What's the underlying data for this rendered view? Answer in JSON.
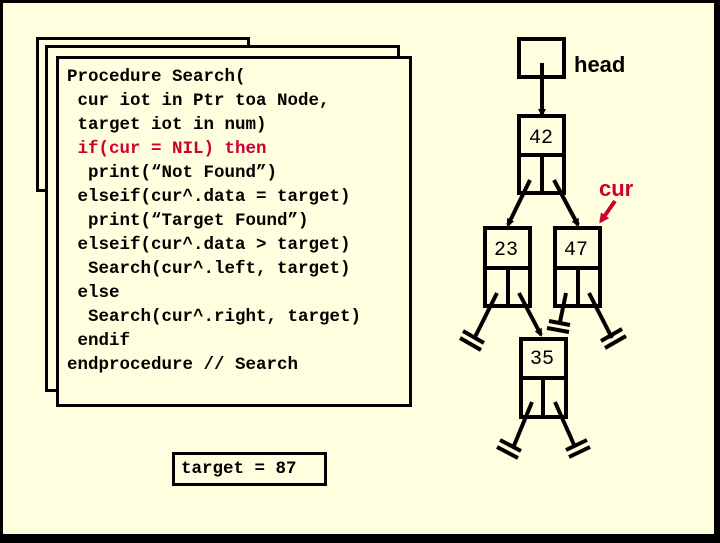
{
  "procedure": {
    "lines": [
      {
        "text": "Procedure Search(",
        "color": "black"
      },
      {
        "text": " cur iot in Ptr toa Node,",
        "color": "black"
      },
      {
        "text": " target iot in num)",
        "color": "black"
      },
      {
        "text": " if(cur = NIL) then",
        "color": "red"
      },
      {
        "text": "  print(“Not Found”)",
        "color": "black"
      },
      {
        "text": " elseif(cur^.data = target)",
        "color": "black"
      },
      {
        "text": "  print(“Target Found”)",
        "color": "black"
      },
      {
        "text": " elseif(cur^.data > target)",
        "color": "black"
      },
      {
        "text": "  Search(cur^.left, target)",
        "color": "black"
      },
      {
        "text": " else",
        "color": "black"
      },
      {
        "text": "  Search(cur^.right, target)",
        "color": "black"
      },
      {
        "text": " endif",
        "color": "black"
      },
      {
        "text": "endprocedure // Search",
        "color": "black"
      }
    ]
  },
  "target_label": "target = 87",
  "tree": {
    "head_label": "head",
    "cur_label": "cur",
    "nodes": [
      {
        "id": "n42",
        "value": "42"
      },
      {
        "id": "n23",
        "value": "23"
      },
      {
        "id": "n47",
        "value": "47"
      },
      {
        "id": "n35",
        "value": "35"
      }
    ]
  },
  "colors": {
    "background": "#ffffe0",
    "highlight": "#cc0033",
    "ink": "#000000"
  }
}
